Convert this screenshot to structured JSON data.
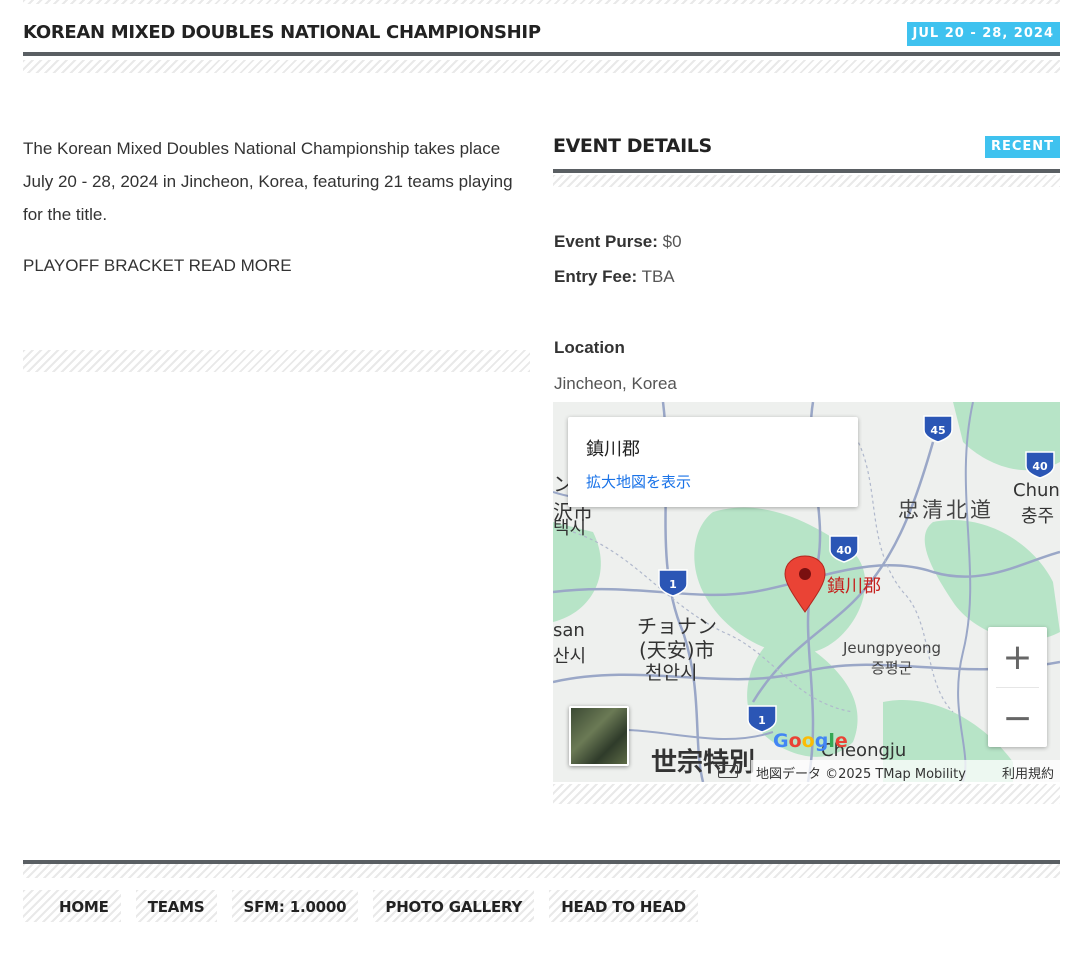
{
  "header": {
    "title": "KOREAN MIXED DOUBLES NATIONAL CHAMPIONSHIP",
    "dates": "JUL 20 - 28, 2024"
  },
  "intro": {
    "description": "The Korean Mixed Doubles National Championship takes place July 20 - 28, 2024 in Jincheon, Korea, featuring 21 teams playing for the title.",
    "link": "PLAYOFF BRACKET READ MORE"
  },
  "event_details": {
    "title": "EVENT DETAILS",
    "badge": "RECENT",
    "purse_label": "Event Purse:",
    "purse_value": "$0",
    "fee_label": "Entry Fee:",
    "fee_value": "TBA",
    "location_label": "Location",
    "location_value": "Jincheon, Korea"
  },
  "map": {
    "place_name": "鎮川郡",
    "view_larger": "拡大地図を表示",
    "pin_label": "鎮川郡",
    "labels": {
      "chungbuk": "忠清北道",
      "chun": "Chun",
      "chungju": "충주",
      "cheonan_ja": "チョナン",
      "cheonan_ja2": "(天安)市",
      "cheonan_ko": "천안시",
      "jeungpyeong": "Jeungpyeong",
      "jeungpyeong_ko": "증평군",
      "sejong": "世宗特別",
      "cheongju": "Cheongju",
      "asan_en": "san",
      "asan_ko": "산시",
      "pyeongtaek_ja": "沢市",
      "pyeongtaek_ko": "택시",
      "left_edge": "ン"
    },
    "route_shields": [
      "45",
      "40",
      "40",
      "1",
      "1"
    ],
    "zoom_in": "+",
    "zoom_out": "−",
    "attribution": "地図データ ©2025 TMap Mobility",
    "terms": "利用規約",
    "google": "Google",
    "colors": {
      "park": "#b7e4c7",
      "road": "#9aa7c7",
      "pin": "#ea4335",
      "link": "#1a73e8"
    }
  },
  "nav": {
    "items": [
      "HOME",
      "TEAMS",
      "SFM: 1.0000",
      "PHOTO GALLERY",
      "HEAD TO HEAD"
    ]
  },
  "theme": {
    "accent": "#3fc2ef",
    "rule": "#5a5f63"
  }
}
